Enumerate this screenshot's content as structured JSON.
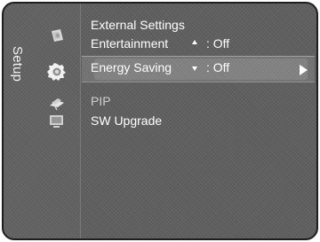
{
  "sidebar": {
    "label": "Setup",
    "icons": [
      {
        "name": "picture-icon"
      },
      {
        "name": "sound-icon"
      },
      {
        "name": "channel-icon"
      },
      {
        "name": "setup-icon"
      }
    ]
  },
  "menu": {
    "items": [
      {
        "label": "External Settings",
        "value": ""
      },
      {
        "label": "Entertainment",
        "value": ": Off"
      },
      {
        "label": "Energy Saving",
        "value": ": Off"
      },
      {
        "label": "PIP",
        "value": ""
      },
      {
        "label": "SW Upgrade",
        "value": ""
      }
    ]
  },
  "colors": {
    "background": "#5f5f5f",
    "text": "#ffffff",
    "muted_text": "#cfcfcf",
    "border": "#1e1e1e"
  }
}
